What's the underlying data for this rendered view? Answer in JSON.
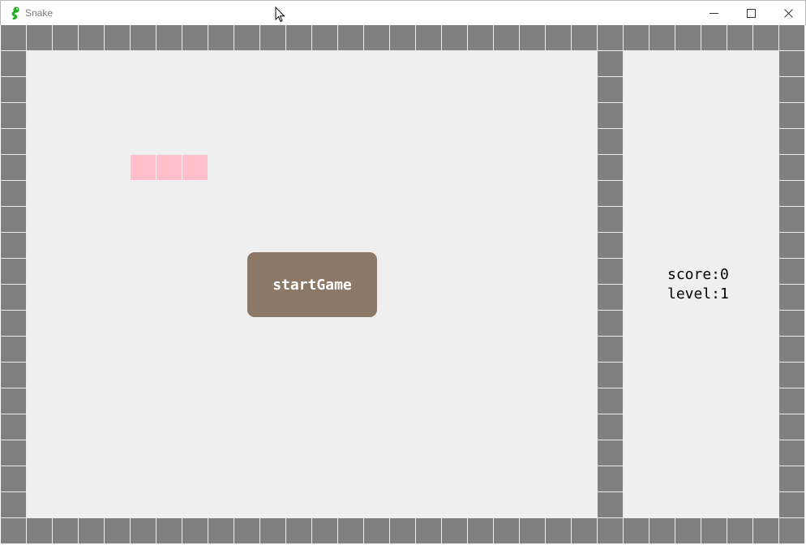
{
  "window": {
    "title": "Snake",
    "app_icon": "snake-icon",
    "controls": [
      "minimize-icon",
      "maximize-icon",
      "close-icon"
    ]
  },
  "game": {
    "wall_color": "#808080",
    "field_color": "#efefef",
    "snake": {
      "color": "#ffc0cb",
      "segments": 3
    },
    "start_button": {
      "label": "startGame",
      "color": "#8b7866"
    }
  },
  "panel": {
    "score_text": "score:0",
    "level_text": "level:1"
  }
}
